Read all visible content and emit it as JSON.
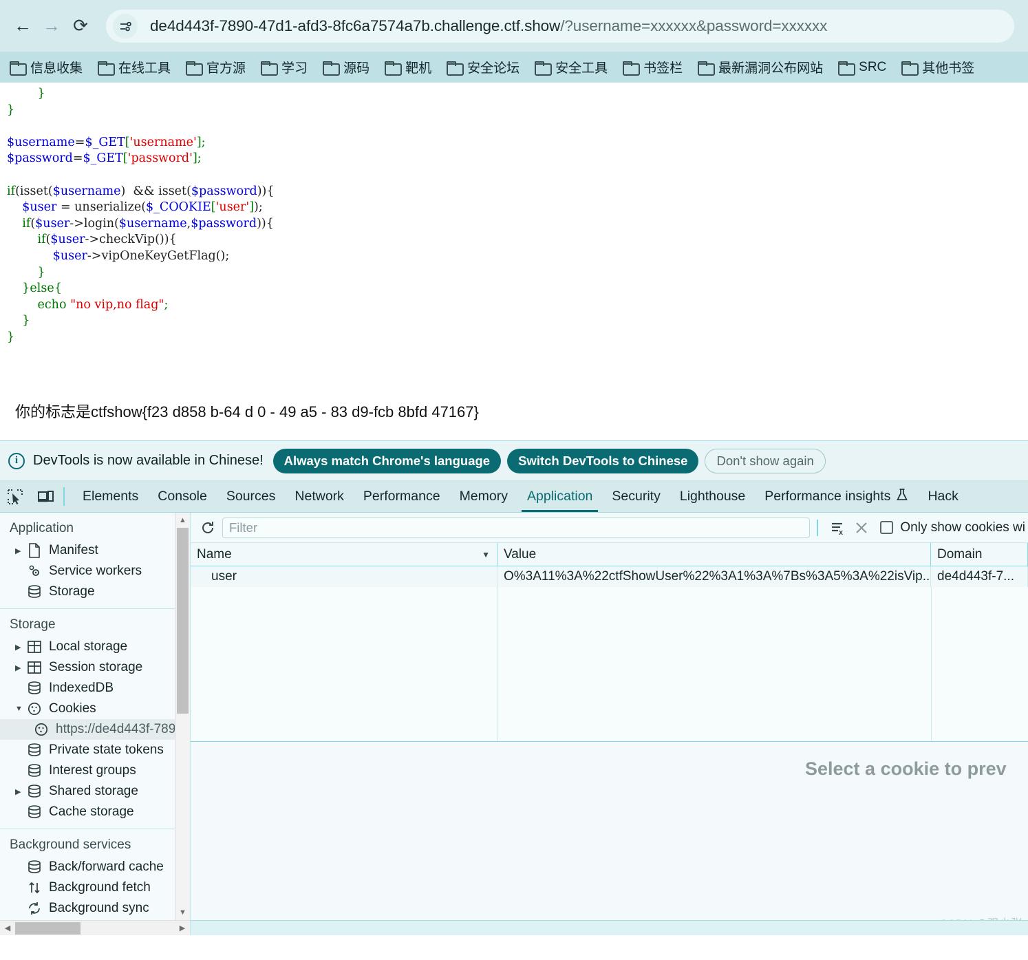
{
  "browser": {
    "nav": {
      "back_icon": "arrow-left-icon",
      "forward_icon": "arrow-right-icon",
      "reload_icon": "reload-icon"
    },
    "omnibox": {
      "site_info_icon": "tune-settings-icon",
      "url_main": "de4d443f-7890-47d1-afd3-8fc6a7574a7b.challenge.ctf.show",
      "url_query": "/?username=xxxxxx&password=xxxxxx",
      "full_url": "de4d443f-7890-47d1-afd3-8fc6a7574a7b.challenge.ctf.show/?username=xxxxxx&password=xxxxxx"
    },
    "bookmarks": [
      {
        "label": "信息收集",
        "icon": "folder-icon"
      },
      {
        "label": "在线工具",
        "icon": "folder-icon"
      },
      {
        "label": "官方源",
        "icon": "folder-icon"
      },
      {
        "label": "学习",
        "icon": "folder-icon"
      },
      {
        "label": "源码",
        "icon": "folder-icon"
      },
      {
        "label": "靶机",
        "icon": "folder-icon"
      },
      {
        "label": "安全论坛",
        "icon": "folder-icon"
      },
      {
        "label": "安全工具",
        "icon": "folder-icon"
      },
      {
        "label": "书签栏",
        "icon": "folder-icon"
      },
      {
        "label": "最新漏洞公布网站",
        "icon": "folder-icon"
      },
      {
        "label": "SRC",
        "icon": "folder-icon"
      },
      {
        "label": "其他书签",
        "icon": "folder-icon"
      }
    ]
  },
  "page": {
    "code_lines": [
      [
        {
          "t": "        }",
          "c": "c-brace"
        }
      ],
      [
        {
          "t": "}",
          "c": "c-brace"
        }
      ],
      [
        {
          "t": "",
          "c": "c-plain"
        }
      ],
      [
        {
          "t": "$username",
          "c": "c-var"
        },
        {
          "t": "=",
          "c": "c-plain"
        },
        {
          "t": "$_GET",
          "c": "c-var"
        },
        {
          "t": "[",
          "c": "c-brace"
        },
        {
          "t": "'username'",
          "c": "c-str"
        },
        {
          "t": "]",
          "c": "c-brace"
        },
        {
          "t": ";",
          "c": "c-op"
        }
      ],
      [
        {
          "t": "$password",
          "c": "c-var"
        },
        {
          "t": "=",
          "c": "c-plain"
        },
        {
          "t": "$_GET",
          "c": "c-var"
        },
        {
          "t": "[",
          "c": "c-brace"
        },
        {
          "t": "'password'",
          "c": "c-str"
        },
        {
          "t": "]",
          "c": "c-brace"
        },
        {
          "t": ";",
          "c": "c-op"
        }
      ],
      [
        {
          "t": "",
          "c": "c-plain"
        }
      ],
      [
        {
          "t": "if",
          "c": "c-kw"
        },
        {
          "t": "(isset(",
          "c": "c-plain"
        },
        {
          "t": "$username",
          "c": "c-var"
        },
        {
          "t": ")  && isset(",
          "c": "c-plain"
        },
        {
          "t": "$password",
          "c": "c-var"
        },
        {
          "t": ")){",
          "c": "c-plain"
        }
      ],
      [
        {
          "t": "    ",
          "c": "c-plain"
        },
        {
          "t": "$user",
          "c": "c-var"
        },
        {
          "t": " = unserialize(",
          "c": "c-plain"
        },
        {
          "t": "$_COOKIE",
          "c": "c-var"
        },
        {
          "t": "[",
          "c": "c-brace"
        },
        {
          "t": "'user'",
          "c": "c-str"
        },
        {
          "t": "]",
          "c": "c-brace"
        },
        {
          "t": ");",
          "c": "c-plain"
        }
      ],
      [
        {
          "t": "    ",
          "c": "c-plain"
        },
        {
          "t": "if",
          "c": "c-kw"
        },
        {
          "t": "(",
          "c": "c-plain"
        },
        {
          "t": "$user",
          "c": "c-var"
        },
        {
          "t": "->login(",
          "c": "c-plain"
        },
        {
          "t": "$username",
          "c": "c-var"
        },
        {
          "t": ",",
          "c": "c-plain"
        },
        {
          "t": "$password",
          "c": "c-var"
        },
        {
          "t": ")){",
          "c": "c-plain"
        }
      ],
      [
        {
          "t": "        ",
          "c": "c-plain"
        },
        {
          "t": "if",
          "c": "c-kw"
        },
        {
          "t": "(",
          "c": "c-plain"
        },
        {
          "t": "$user",
          "c": "c-var"
        },
        {
          "t": "->checkVip()){",
          "c": "c-plain"
        }
      ],
      [
        {
          "t": "            ",
          "c": "c-plain"
        },
        {
          "t": "$user",
          "c": "c-var"
        },
        {
          "t": "->vipOneKeyGetFlag();",
          "c": "c-plain"
        }
      ],
      [
        {
          "t": "        }",
          "c": "c-brace"
        }
      ],
      [
        {
          "t": "    }",
          "c": "c-brace"
        },
        {
          "t": "else",
          "c": "c-kw"
        },
        {
          "t": "{",
          "c": "c-brace"
        }
      ],
      [
        {
          "t": "        ",
          "c": "c-plain"
        },
        {
          "t": "echo",
          "c": "c-kw"
        },
        {
          "t": " ",
          "c": "c-plain"
        },
        {
          "t": "\"no vip,no flag\"",
          "c": "c-str"
        },
        {
          "t": ";",
          "c": "c-op"
        }
      ],
      [
        {
          "t": "    }",
          "c": "c-brace"
        }
      ],
      [
        {
          "t": "}",
          "c": "c-brace"
        }
      ]
    ],
    "flag_text": "你的标志是ctfshow{f23 d858 b-64 d 0 - 49 a5 - 83 d9-fcb 8bfd 47167}"
  },
  "devtools": {
    "notice": {
      "info_icon": "info-icon",
      "text": "DevTools is now available in Chinese!",
      "primary_btn": "Always match Chrome's language",
      "secondary_btn": "Switch DevTools to Chinese",
      "ghost_btn": "Don't show again"
    },
    "toolbar_icons": [
      {
        "name": "inspect-element-icon"
      },
      {
        "name": "device-toolbar-icon"
      }
    ],
    "tabs": [
      {
        "label": "Elements",
        "active": false
      },
      {
        "label": "Console",
        "active": false
      },
      {
        "label": "Sources",
        "active": false
      },
      {
        "label": "Network",
        "active": false
      },
      {
        "label": "Performance",
        "active": false
      },
      {
        "label": "Memory",
        "active": false
      },
      {
        "label": "Application",
        "active": true
      },
      {
        "label": "Security",
        "active": false
      },
      {
        "label": "Lighthouse",
        "active": false
      },
      {
        "label": "Performance insights",
        "active": false,
        "icon": "flask-icon"
      },
      {
        "label": "Hack",
        "active": false
      }
    ],
    "sidebar": {
      "groups": [
        {
          "title": "Application",
          "items": [
            {
              "label": "Manifest",
              "icon": "document-icon",
              "twisty": "collapsed",
              "selected": false
            },
            {
              "label": "Service workers",
              "icon": "gears-icon",
              "twisty": "none",
              "selected": false
            },
            {
              "label": "Storage",
              "icon": "database-icon",
              "twisty": "none",
              "selected": false
            }
          ]
        },
        {
          "title": "Storage",
          "items": [
            {
              "label": "Local storage",
              "icon": "table-icon",
              "twisty": "collapsed",
              "selected": false
            },
            {
              "label": "Session storage",
              "icon": "table-icon",
              "twisty": "collapsed",
              "selected": false
            },
            {
              "label": "IndexedDB",
              "icon": "database-icon",
              "twisty": "none",
              "selected": false
            },
            {
              "label": "Cookies",
              "icon": "cookie-icon",
              "twisty": "expanded",
              "selected": false
            },
            {
              "label": "https://de4d443f-789",
              "icon": "cookie-icon",
              "twisty": "none",
              "selected": true,
              "indent": true
            },
            {
              "label": "Private state tokens",
              "icon": "database-icon",
              "twisty": "none",
              "selected": false
            },
            {
              "label": "Interest groups",
              "icon": "database-icon",
              "twisty": "none",
              "selected": false
            },
            {
              "label": "Shared storage",
              "icon": "database-icon",
              "twisty": "collapsed",
              "selected": false
            },
            {
              "label": "Cache storage",
              "icon": "database-icon",
              "twisty": "none",
              "selected": false
            }
          ]
        },
        {
          "title": "Background services",
          "items": [
            {
              "label": "Back/forward cache",
              "icon": "database-icon",
              "twisty": "none",
              "selected": false
            },
            {
              "label": "Background fetch",
              "icon": "updown-arrows-icon",
              "twisty": "none",
              "selected": false
            },
            {
              "label": "Background sync",
              "icon": "sync-icon",
              "twisty": "none",
              "selected": false
            }
          ]
        }
      ]
    },
    "cookie_panel": {
      "refresh_icon": "refresh-icon",
      "filter_placeholder": "Filter",
      "clear_all_icon": "clear-all-cookies-icon",
      "delete_icon": "delete-cookie-icon",
      "only_show_label": "Only show cookies wi",
      "columns": [
        "Name",
        "Value",
        "Domain"
      ],
      "sort_column": "Name",
      "rows": [
        {
          "name": "user",
          "value": "O%3A11%3A%22ctfShowUser%22%3A1%3A%7Bs%3A5%3A%22isVip...",
          "domain": "de4d443f-7..."
        }
      ],
      "preview_placeholder": "Select a cookie to prev"
    },
    "watermark": "CSDN @强少张"
  },
  "colors": {
    "chrome_bg": "#d5eaec",
    "bookmarks_bg": "#bfe0e5",
    "devtools_accent": "#0a6b73",
    "devtools_bg": "#e8f4f5",
    "panel_bg": "#f7fcfd",
    "grid_line": "#84dbe8"
  }
}
